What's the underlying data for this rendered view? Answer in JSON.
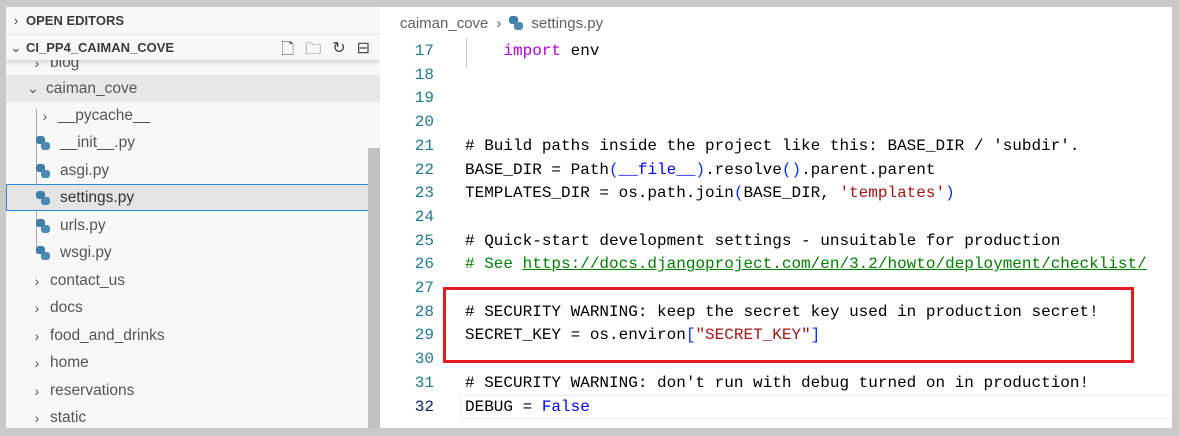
{
  "sidebar": {
    "open_editors": "OPEN EDITORS",
    "project": "CI_PP4_CAIMAN_COVE",
    "actions": [
      "new-file",
      "new-folder",
      "refresh",
      "collapse-all"
    ],
    "items": [
      {
        "label": "blog",
        "type": "folder"
      },
      {
        "label": "caiman_cove",
        "type": "folder-open"
      },
      {
        "label": "__pycache__",
        "type": "folder"
      },
      {
        "label": "__init__.py",
        "type": "python"
      },
      {
        "label": "asgi.py",
        "type": "python"
      },
      {
        "label": "settings.py",
        "type": "python"
      },
      {
        "label": "urls.py",
        "type": "python"
      },
      {
        "label": "wsgi.py",
        "type": "python"
      },
      {
        "label": "contact_us",
        "type": "folder"
      },
      {
        "label": "docs",
        "type": "folder"
      },
      {
        "label": "food_and_drinks",
        "type": "folder"
      },
      {
        "label": "home",
        "type": "folder"
      },
      {
        "label": "reservations",
        "type": "folder"
      },
      {
        "label": "static",
        "type": "folder"
      }
    ]
  },
  "breadcrumb": {
    "folder": "caiman_cove",
    "file": "settings.py"
  },
  "code": {
    "l17": {
      "n": "17",
      "kw": "import",
      "rest": " env"
    },
    "l18": {
      "n": "18"
    },
    "l19": {
      "n": "19"
    },
    "l20": {
      "n": "20"
    },
    "l21": {
      "n": "21",
      "text": "# Build paths inside the project like this: BASE_DIR / 'subdir'."
    },
    "l22": {
      "n": "22",
      "a": "BASE_DIR = Path",
      "b": "(",
      "c": "__file__",
      "d": ")",
      "e": ".resolve",
      "f": "()",
      "g": ".parent.parent"
    },
    "l23": {
      "n": "23",
      "a": "TEMPLATES_DIR = os.path.join",
      "b": "(",
      "c": "BASE_DIR, ",
      "s": "'templates'",
      "d": ")"
    },
    "l24": {
      "n": "24"
    },
    "l25": {
      "n": "25",
      "text": "# Quick-start development settings - unsuitable for production"
    },
    "l26": {
      "n": "26",
      "pre": "# See ",
      "url": "https://docs.djangoproject.com/en/3.2/howto/deployment/checklist/"
    },
    "l27": {
      "n": "27"
    },
    "l28": {
      "n": "28",
      "text": "# SECURITY WARNING: keep the secret key used in production secret!"
    },
    "l29": {
      "n": "29",
      "a": "SECRET_KEY = os.environ",
      "b": "[",
      "s": "\"SECRET_KEY\"",
      "d": "]"
    },
    "l30": {
      "n": "30"
    },
    "l31": {
      "n": "31",
      "text": "# SECURITY WARNING: don't run with debug turned on in production!"
    },
    "l32": {
      "n": "32",
      "a": "DEBUG = ",
      "v": "False"
    }
  },
  "colors": {
    "highlight_box": "#e31c23",
    "comment": "#008000",
    "keyword": "#af00db",
    "string": "#a31515"
  }
}
